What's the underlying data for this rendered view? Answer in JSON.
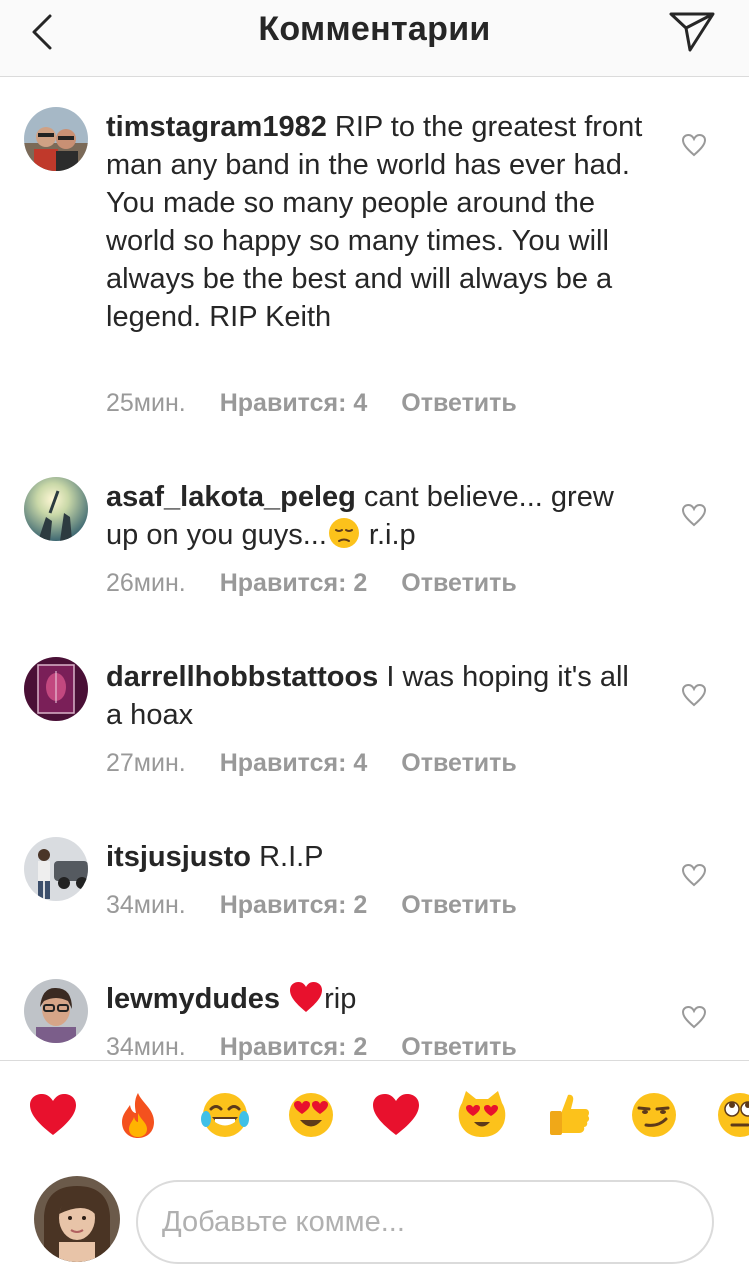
{
  "header": {
    "title": "Комментарии",
    "back_icon": "chevron-left-icon",
    "send_icon": "direct-send-icon"
  },
  "comments": [
    {
      "username": "timstagram1982",
      "text": " RIP to the greatest front man any band in the world has ever had. You made so many people around the world so happy so many times. You will always be the best and will always be a legend. RIP Keith",
      "time": "25мин.",
      "likes": "Нравится: 4",
      "reply": "Ответить"
    },
    {
      "username": "asaf_lakota_peleg",
      "text_before": " cant believe... grew up on you guys...",
      "emoji": "pensive-face-emoji",
      "text_after": " r.i.p",
      "time": "26мин.",
      "likes": "Нравится: 2",
      "reply": "Ответить"
    },
    {
      "username": "darrellhobbstattoos",
      "text": " I was hoping it's all a hoax",
      "time": "27мин.",
      "likes": "Нравится: 4",
      "reply": "Ответить"
    },
    {
      "username": "itsjusjusto",
      "text": " R.I.P",
      "time": "34мин.",
      "likes": "Нравится: 2",
      "reply": "Ответить"
    },
    {
      "username": "lewmydudes",
      "emoji": "red-heart-emoji",
      "text_after": "rip",
      "time": "34мин.",
      "likes": "Нравится: 2",
      "reply": "Ответить"
    }
  ],
  "emoji_bar": [
    "red-heart-emoji",
    "fire-emoji",
    "tears-of-joy-emoji",
    "heart-eyes-emoji",
    "red-heart-emoji",
    "heart-eyes-cat-emoji",
    "thumbs-up-emoji",
    "smirking-face-emoji",
    "rolling-eyes-emoji"
  ],
  "composer": {
    "placeholder": "Добавьте комме..."
  },
  "colors": {
    "text": "#262626",
    "secondary": "#999999",
    "divider": "#dbdbdb",
    "heart_red": "#e8112d"
  }
}
